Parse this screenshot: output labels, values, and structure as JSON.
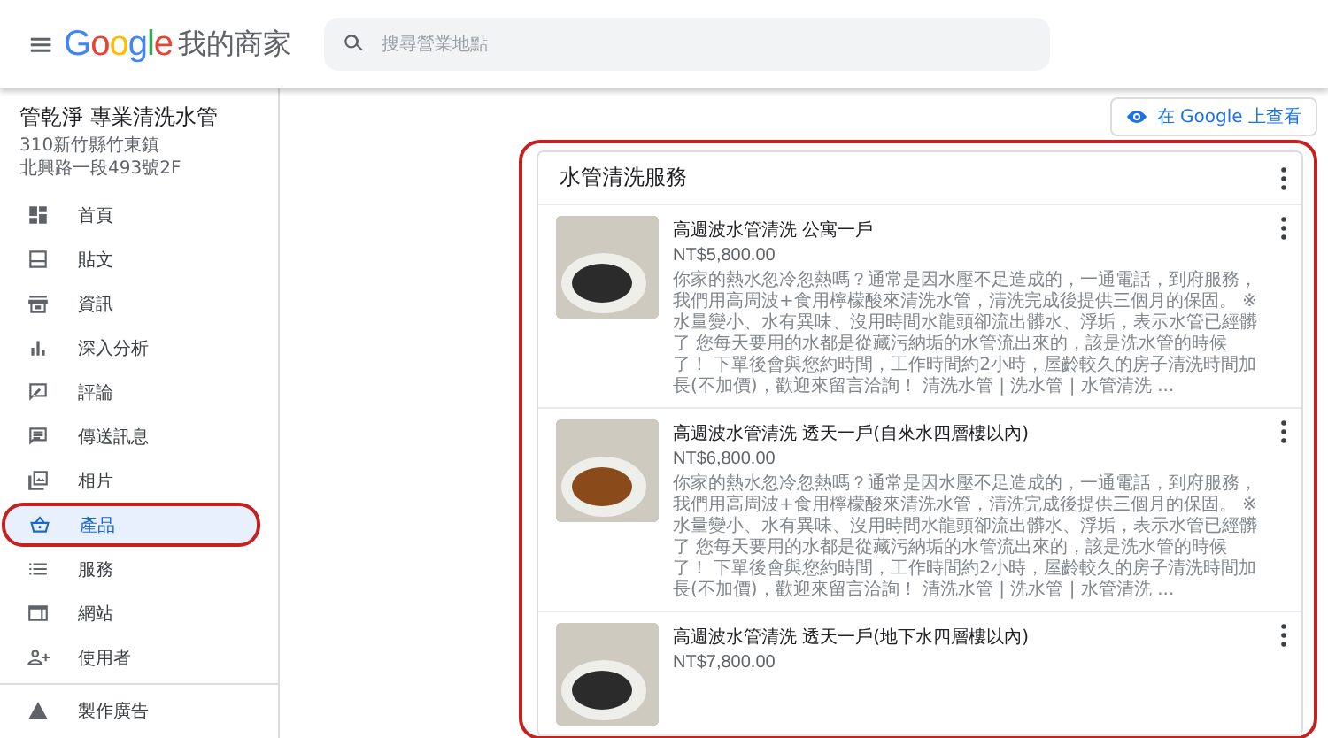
{
  "header": {
    "menu_icon": "≡",
    "logo": "Google",
    "product_name": "我的商家",
    "search": {
      "placeholder": "搜尋營業地點"
    }
  },
  "business": {
    "name": "管乾淨 專業清洗水管",
    "address_lines": [
      "310新竹縣竹東鎮",
      "北興路一段493號2F"
    ]
  },
  "sidebar": {
    "items": [
      {
        "label": "首頁",
        "selected": false,
        "circled": false
      },
      {
        "label": "貼文",
        "selected": false,
        "circled": false
      },
      {
        "label": "資訊",
        "selected": false,
        "circled": false
      },
      {
        "label": "深入分析",
        "selected": false,
        "circled": false
      },
      {
        "label": "評論",
        "selected": false,
        "circled": false
      },
      {
        "label": "傳送訊息",
        "selected": false,
        "circled": false
      },
      {
        "label": "相片",
        "selected": false,
        "circled": false
      },
      {
        "label": "產品",
        "selected": true,
        "circled": true
      },
      {
        "label": "服務",
        "selected": false,
        "circled": false
      },
      {
        "label": "網站",
        "selected": false,
        "circled": false
      },
      {
        "label": "使用者",
        "selected": false,
        "circled": false
      },
      {
        "label": "製作廣告",
        "selected": false,
        "circled": false,
        "divider_before": true
      }
    ]
  },
  "view_button": "在 Google 上查看",
  "category": {
    "title": "水管清洗服務",
    "circled": true,
    "products": [
      {
        "name": "高週波水管清洗 公寓一戶",
        "price": "NT$5,800.00",
        "description": "你家的熱水忽冷忽熱嗎？通常是因水壓不足造成的，一通電話，到府服務，我們用高周波+食用檸檬酸來清洗水管，清洗完成後提供三個月的保固。 ※水量變小、水有異味、沒用時間水龍頭卻流出髒水、浮垢，表示水管已經髒了 您每天要用的水都是從藏污納垢的水管流出來的，該是洗水管的時候了！ 下單後會與您約時間，工作時間約2小時，屋齡較久的房子清洗時間加長(不加價)，歡迎來留言洽詢！ 清洗水管 | 洗水管 | 水管清洗 ..."
      },
      {
        "name": "高週波水管清洗 透天一戶(自來水四層樓以內)",
        "price": "NT$6,800.00",
        "description": "你家的熱水忽冷忽熱嗎？通常是因水壓不足造成的，一通電話，到府服務，我們用高周波+食用檸檬酸來清洗水管，清洗完成後提供三個月的保固。 ※水量變小、水有異味、沒用時間水龍頭卻流出髒水、浮垢，表示水管已經髒了 您每天要用的水都是從藏污納垢的水管流出來的，該是洗水管的時候了！ 下單後會與您約時間，工作時間約2小時，屋齡較久的房子清洗時間加長(不加價)，歡迎來留言洽詢！ 清洗水管 | 洗水管 | 水管清洗 ..."
      },
      {
        "name": "高週波水管清洗 透天一戶(地下水四層樓以內)",
        "price": "NT$7,800.00"
      }
    ]
  }
}
